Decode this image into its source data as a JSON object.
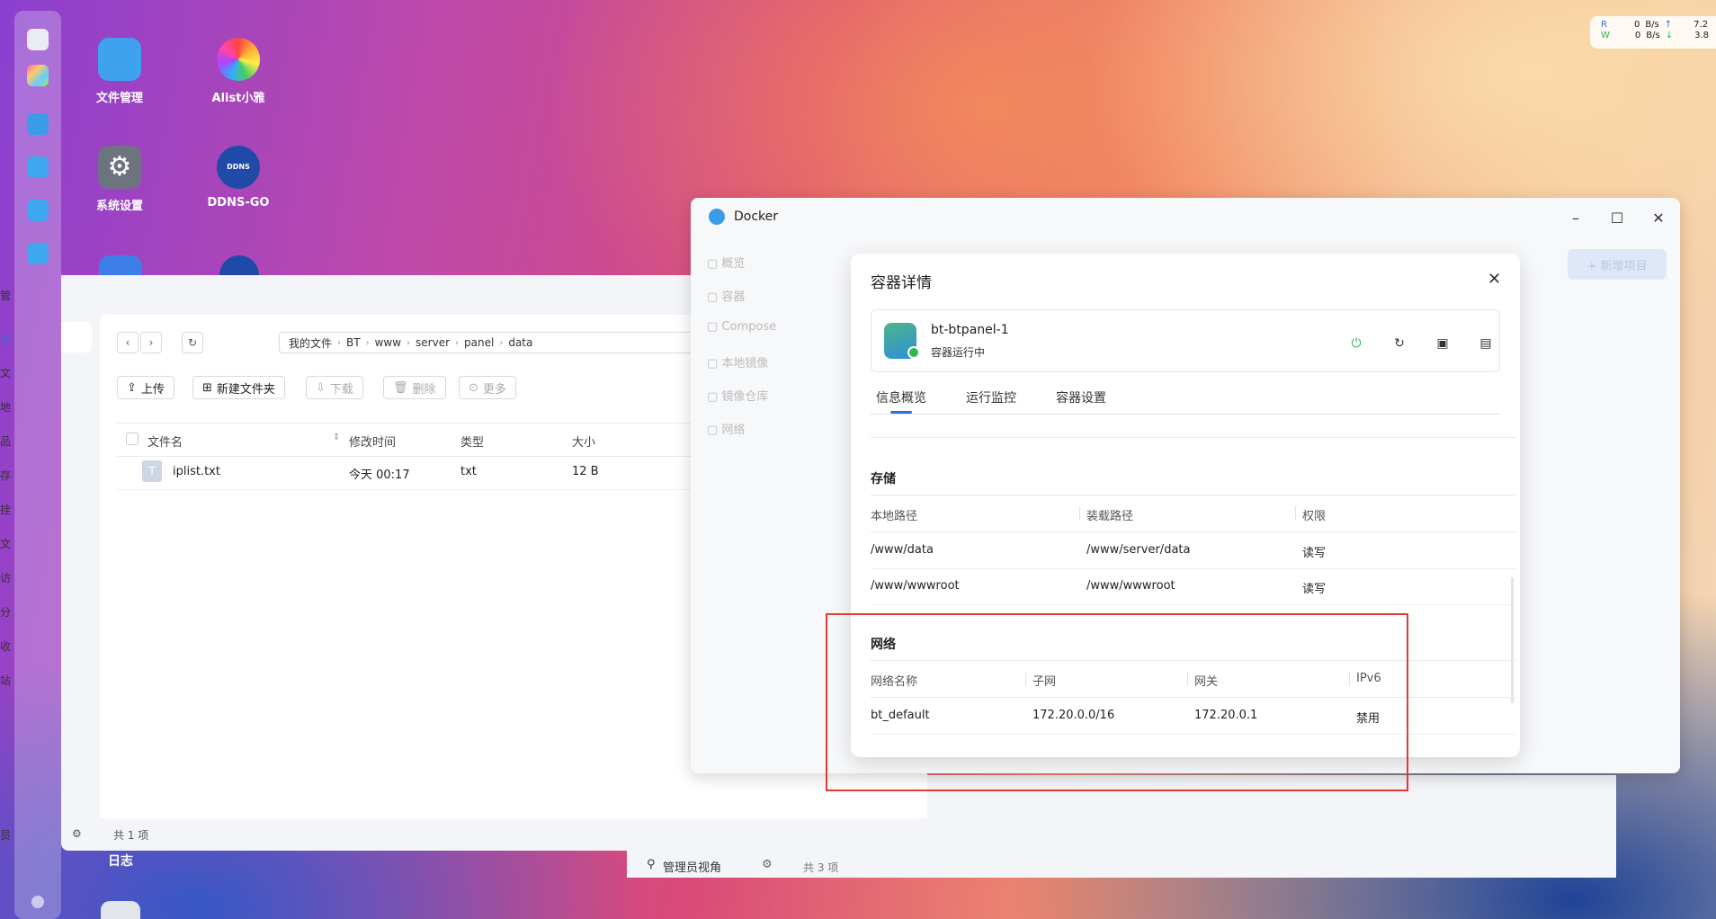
{
  "netspeed": {
    "r_label": "R",
    "w_label": "W",
    "r_val": "0",
    "w_val": "0",
    "unit": "B/s",
    "r_total": "7.2",
    "w_total": "3.8"
  },
  "desktop_icons": [
    {
      "label": "文件管理"
    },
    {
      "label": "Alist小雅"
    },
    {
      "label": "系统设置"
    },
    {
      "label": "DDNS-GO"
    }
  ],
  "desktop_bottom_label": "日志",
  "left_strip": [
    "管",
    "文",
    "文",
    "地",
    "品",
    "存",
    "挂",
    "文",
    "访",
    "分",
    "收",
    "站",
    "员"
  ],
  "filemanager": {
    "breadcrumb": [
      "我的文件",
      "BT",
      "www",
      "server",
      "panel",
      "data"
    ],
    "toolbar": {
      "upload": "上传",
      "new_folder": "新建文件夹",
      "download": "下载",
      "delete": "删除",
      "more": "更多"
    },
    "columns": {
      "name": "文件名",
      "modified": "修改时间",
      "type": "类型",
      "size": "大小"
    },
    "rows": [
      {
        "name": "iplist.txt",
        "modified": "今天 00:17",
        "type": "txt",
        "size": "12 B"
      }
    ],
    "status": "共 1 项"
  },
  "backwin": {
    "label": "管理员视角",
    "status": "共 3 项"
  },
  "docker": {
    "title": "Docker",
    "sidebar": [
      "概览",
      "容器",
      "Compose",
      "本地镜像",
      "镜像仓库",
      "网络"
    ],
    "new_button": "+ 新增项目"
  },
  "modal": {
    "title": "容器详情",
    "container_name": "bt-btpanel-1",
    "container_status": "容器运行中",
    "status_color": "#2db84d",
    "tabs": [
      "信息概览",
      "运行监控",
      "容器设置"
    ],
    "storage": {
      "title": "存储",
      "headers": [
        "本地路径",
        "装载路径",
        "权限"
      ],
      "rows": [
        [
          "/www/data",
          "/www/server/data",
          "读写"
        ],
        [
          "/www/wwwroot",
          "/www/wwwroot",
          "读写"
        ]
      ]
    },
    "network": {
      "title": "网络",
      "headers": [
        "网络名称",
        "子网",
        "网关",
        "IPv6"
      ],
      "rows": [
        [
          "bt_default",
          "172.20.0.0/16",
          "172.20.0.1",
          "禁用"
        ]
      ]
    }
  }
}
